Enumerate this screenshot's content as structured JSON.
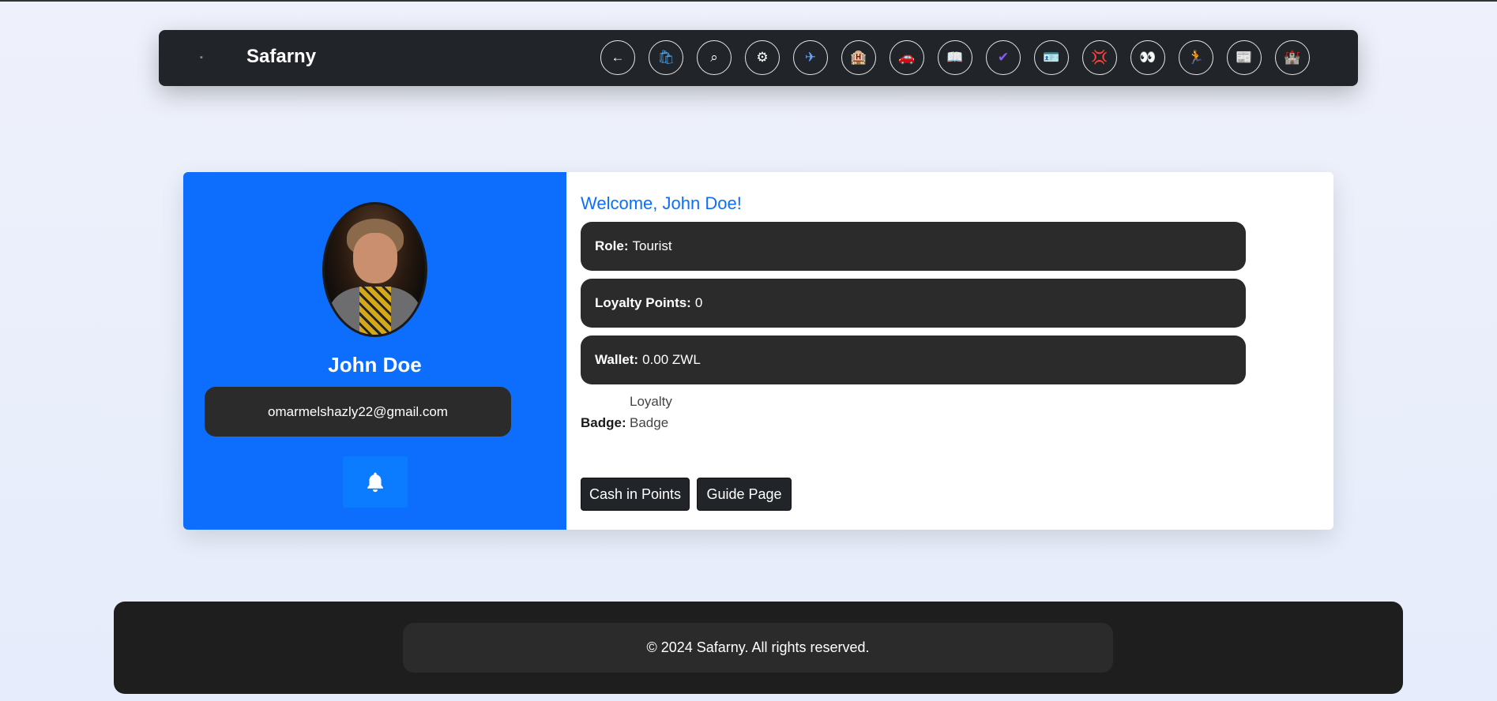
{
  "navbar": {
    "brand_name": "Safarny",
    "brand_logo_alt": "▪",
    "icons": [
      {
        "name": "back-arrow-icon",
        "glyph": "←",
        "color": "#ffffff"
      },
      {
        "name": "shopping-bags-icon",
        "glyph": "🛍",
        "color": "#4aa3f0"
      },
      {
        "name": "search-icon",
        "glyph": "⌕",
        "color": "#ffffff"
      },
      {
        "name": "gear-icon",
        "glyph": "⚙",
        "color": "#ffffff"
      },
      {
        "name": "airplane-icon",
        "glyph": "✈",
        "color": "#5fa8ff"
      },
      {
        "name": "hotel-icon",
        "glyph": "🏨",
        "color": "#e0a060"
      },
      {
        "name": "car-icon",
        "glyph": "🚗",
        "color": "#e05050"
      },
      {
        "name": "book-icon",
        "glyph": "📖",
        "color": "#8ab8e6"
      },
      {
        "name": "checkmark-icon",
        "glyph": "✔",
        "color": "#8a5cf6"
      },
      {
        "name": "id-card-icon",
        "glyph": "🪪",
        "color": "#4ab0f0"
      },
      {
        "name": "complaint-icon",
        "glyph": "💢",
        "color": "#e53935"
      },
      {
        "name": "eyes-icon",
        "glyph": "👀",
        "color": "#ffffff"
      },
      {
        "name": "runner-icon",
        "glyph": "🏃",
        "color": "#f0a030"
      },
      {
        "name": "calendar-icon",
        "glyph": "📰",
        "color": "#c0b0c8"
      },
      {
        "name": "castle-icon",
        "glyph": "🏰",
        "color": "#e07080"
      }
    ]
  },
  "profile": {
    "name": "John Doe",
    "email": "omarmelshazly22@gmail.com",
    "notification_icon": "bell-icon"
  },
  "details": {
    "welcome": "Welcome, John Doe!",
    "rows": [
      {
        "label": "Role:",
        "value": "Tourist"
      },
      {
        "label": "Loyalty Points:",
        "value": "0"
      },
      {
        "label": "Wallet:",
        "value": "0.00 ZWL"
      }
    ],
    "badge_label": "Badge:",
    "badge_alt": "Loyalty Badge",
    "buttons": {
      "cash_in": "Cash in Points",
      "guide": "Guide Page"
    }
  },
  "footer": {
    "text": "© 2024 Safarny. All rights reserved."
  },
  "colors": {
    "primary": "#0d6efd",
    "dark": "#212529",
    "pill": "#2b2b2b"
  }
}
